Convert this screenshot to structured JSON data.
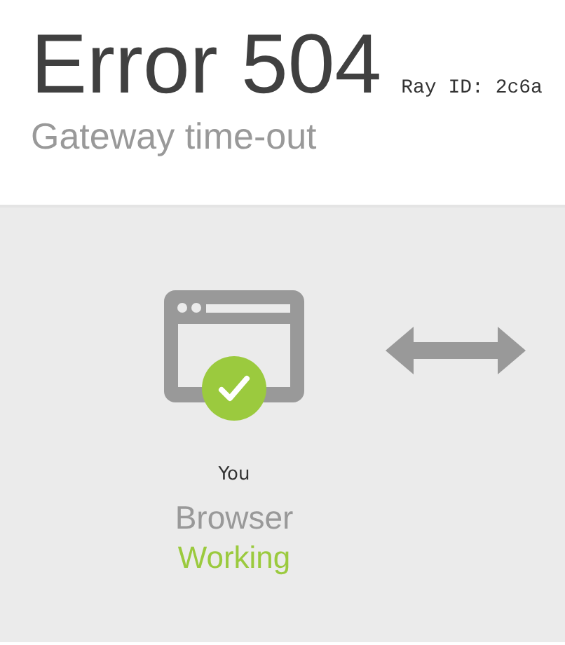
{
  "header": {
    "title": "Error 504",
    "ray_id": "Ray ID: 2c6a",
    "subtitle": "Gateway time-out"
  },
  "nodes": [
    {
      "caption": "You",
      "name": "Browser",
      "status": {
        "text": "Working",
        "kind": "ok"
      }
    }
  ]
}
